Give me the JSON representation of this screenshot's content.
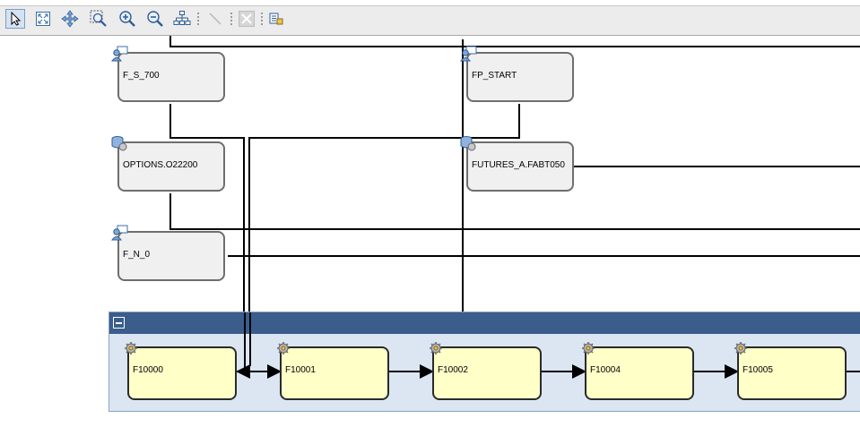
{
  "toolbar": {
    "tools": [
      {
        "name": "select-tool",
        "icon": "pointer-arrow-icon",
        "active": true
      },
      {
        "name": "fit-to-screen-tool",
        "icon": "fit-screen-icon"
      },
      {
        "name": "pan-tool",
        "icon": "move-arrows-icon"
      },
      {
        "name": "zoom-region-tool",
        "icon": "zoom-region-icon"
      },
      {
        "name": "zoom-in-tool",
        "icon": "zoom-in-icon"
      },
      {
        "name": "zoom-out-tool",
        "icon": "zoom-out-icon"
      },
      {
        "name": "auto-layout-tool",
        "icon": "hierarchy-icon"
      },
      {
        "name": "connector-tool",
        "icon": "connector-line-icon",
        "disabled": true
      },
      {
        "name": "delete-tool",
        "icon": "delete-x-icon",
        "disabled": true
      },
      {
        "name": "properties-tool",
        "icon": "properties-icon"
      }
    ]
  },
  "flow": {
    "nodes": [
      {
        "id": "fs700",
        "label": "F_S_700",
        "icon": "user-message-icon"
      },
      {
        "id": "options",
        "label": "OPTIONS.O22200",
        "icon": "database-job-icon"
      },
      {
        "id": "fn0",
        "label": "F_N_0",
        "icon": "user-message-icon"
      },
      {
        "id": "fpstart",
        "label": "FP_START",
        "icon": "user-message-icon"
      },
      {
        "id": "futures",
        "label": "FUTURES_A.FABT050",
        "icon": "database-job-icon"
      }
    ],
    "group": {
      "steps": [
        {
          "id": "f10000",
          "label": "F10000",
          "icon": "gear-icon"
        },
        {
          "id": "f10001",
          "label": "F10001",
          "icon": "gear-icon"
        },
        {
          "id": "f10002",
          "label": "F10002",
          "icon": "gear-icon"
        },
        {
          "id": "f10004",
          "label": "F10004",
          "icon": "gear-icon"
        },
        {
          "id": "f10005",
          "label": "F10005",
          "icon": "gear-icon"
        }
      ]
    }
  },
  "colors": {
    "node_fill": "#f0f0f0",
    "step_fill": "#ffffc8",
    "group_header": "#3a5d8c",
    "group_body": "#dce6f2",
    "line": "#000000"
  }
}
